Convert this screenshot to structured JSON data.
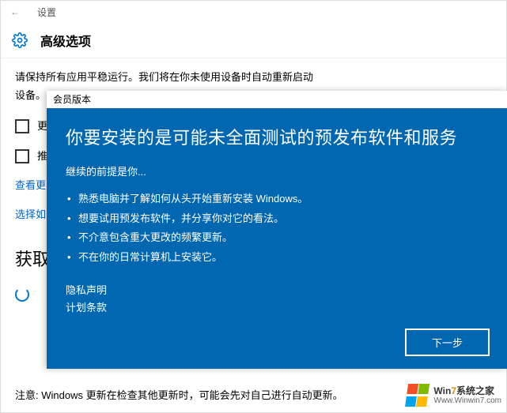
{
  "header": {
    "back_icon": "←",
    "breadcrumb": "设置"
  },
  "page": {
    "title": "高级选项",
    "intro_line1": "请保持所有应用平稳运行。我们将在你未使用设备时自动重新启动",
    "intro_line2": "设备。",
    "checkbox1_label": "更",
    "checkbox2_label": "推",
    "link_view": "查看更",
    "link_choose": "选择如",
    "section_get": "获取",
    "footnote": "注意: Windows 更新在检查其他更新时，可能会先对自己进行自动更新。"
  },
  "dialog": {
    "titlebar": "会员版本",
    "heading": "你要安装的是可能未全面测试的预发布软件和服务",
    "subtitle": "继续的前提是你...",
    "bullets": [
      "熟悉电脑并了解如何从头开始重新安装 Windows。",
      "想要试用预发布软件，并分享你对它的看法。",
      "不介意包含重大更改的频繁更新。",
      "不在你的日常计算机上安装它。"
    ],
    "link_privacy": "隐私声明",
    "link_terms": "计划条款",
    "next_button": "下一步"
  },
  "watermark": {
    "line1": "Win7系统之家",
    "line2": "Www.Winwin7.com"
  }
}
